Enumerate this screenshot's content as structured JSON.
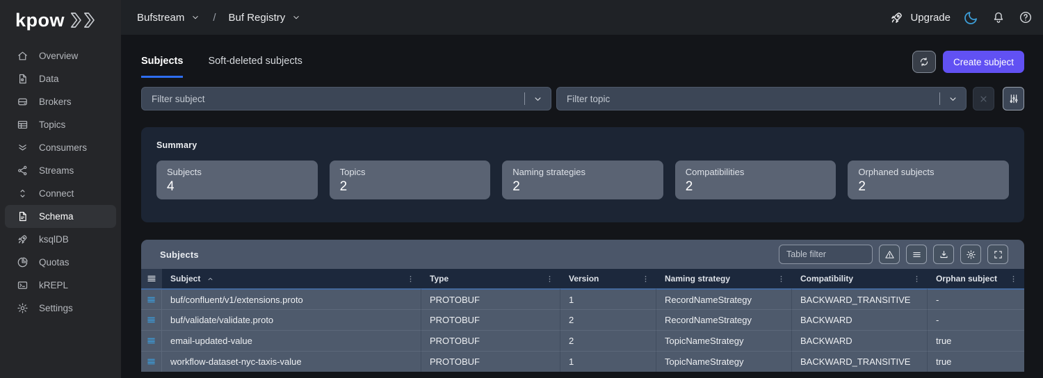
{
  "brand": {
    "logo_text": "kpow"
  },
  "topbar": {
    "breadcrumb": {
      "environment": "Bufstream",
      "separator": "/",
      "section": "Buf Registry"
    },
    "upgrade_label": "Upgrade",
    "icons": [
      "moon",
      "bell",
      "help"
    ]
  },
  "sidebar": {
    "items": [
      {
        "label": "Overview",
        "icon": "home"
      },
      {
        "label": "Data",
        "icon": "data-doc"
      },
      {
        "label": "Brokers",
        "icon": "drive"
      },
      {
        "label": "Topics",
        "icon": "table"
      },
      {
        "label": "Consumers",
        "icon": "chevrons-down"
      },
      {
        "label": "Streams",
        "icon": "share"
      },
      {
        "label": "Connect",
        "icon": "sort-vertical"
      },
      {
        "label": "Schema",
        "icon": "schema-doc",
        "active": true
      },
      {
        "label": "ksqlDB",
        "icon": "rocket"
      },
      {
        "label": "Quotas",
        "icon": "pie"
      },
      {
        "label": "kREPL",
        "icon": "terminal"
      },
      {
        "label": "Settings",
        "icon": "gear"
      }
    ]
  },
  "tabs": [
    {
      "label": "Subjects",
      "active": true
    },
    {
      "label": "Soft-deleted subjects",
      "active": false
    }
  ],
  "actions": {
    "create_subject_label": "Create subject"
  },
  "filters": {
    "subject_placeholder": "Filter subject",
    "topic_placeholder": "Filter topic"
  },
  "summary": {
    "title": "Summary",
    "stats": [
      {
        "label": "Subjects",
        "value": "4"
      },
      {
        "label": "Topics",
        "value": "2"
      },
      {
        "label": "Naming strategies",
        "value": "2"
      },
      {
        "label": "Compatibilities",
        "value": "2"
      },
      {
        "label": "Orphaned subjects",
        "value": "2"
      }
    ]
  },
  "table": {
    "title": "Subjects",
    "filter_placeholder": "Table filter",
    "tools": [
      "warning",
      "list",
      "download",
      "gear",
      "expand"
    ],
    "columns": [
      "Subject",
      "Type",
      "Version",
      "Naming strategy",
      "Compatibility",
      "Orphan subject"
    ],
    "sort": {
      "column": "Subject",
      "direction": "asc"
    },
    "rows": [
      {
        "subject": "buf/confluent/v1/extensions.proto",
        "type": "PROTOBUF",
        "version": "1",
        "naming_strategy": "RecordNameStrategy",
        "compatibility": "BACKWARD_TRANSITIVE",
        "orphan": "-"
      },
      {
        "subject": "buf/validate/validate.proto",
        "type": "PROTOBUF",
        "version": "2",
        "naming_strategy": "RecordNameStrategy",
        "compatibility": "BACKWARD",
        "orphan": "-"
      },
      {
        "subject": "email-updated-value",
        "type": "PROTOBUF",
        "version": "2",
        "naming_strategy": "TopicNameStrategy",
        "compatibility": "BACKWARD",
        "orphan": "true"
      },
      {
        "subject": "workflow-dataset-nyc-taxis-value",
        "type": "PROTOBUF",
        "version": "1",
        "naming_strategy": "TopicNameStrategy",
        "compatibility": "BACKWARD_TRANSITIVE",
        "orphan": "true"
      }
    ]
  },
  "colors": {
    "accent_purple": "#6151f3",
    "tab_accent_blue": "#2e6df0",
    "moon_blue": "#3d9fd9",
    "row_handle_blue": "#3aa4e8",
    "header_underline_blue": "#44699c"
  }
}
